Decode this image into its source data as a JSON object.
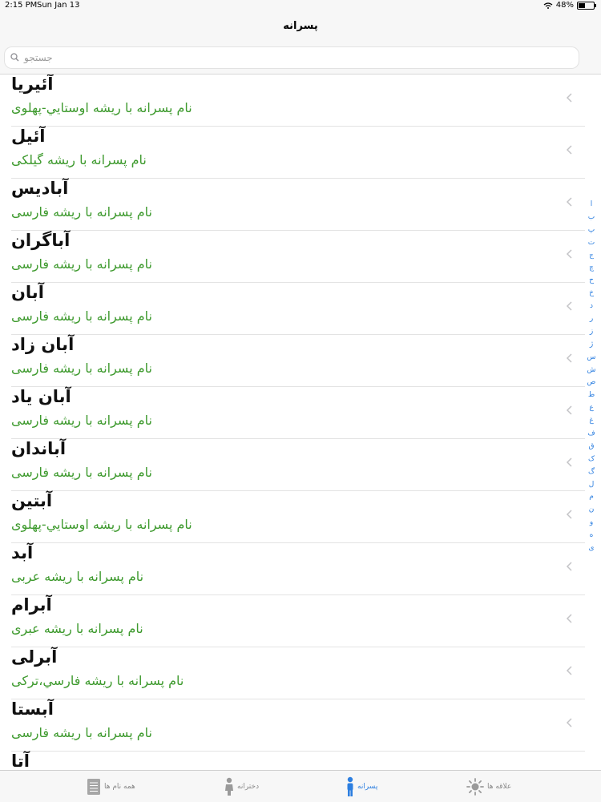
{
  "status": {
    "time": "2:15 PM",
    "date": "Sun Jan 13",
    "battery": "48%",
    "battery_level": 0.48
  },
  "nav": {
    "title": "پسرانه"
  },
  "search": {
    "placeholder": "جستجو"
  },
  "rows": [
    {
      "name": "آئيريا",
      "origin": "نام پسرانه با ریشه اوستايي-پهلوی"
    },
    {
      "name": "آئیل",
      "origin": "نام پسرانه با ریشه گیلکی"
    },
    {
      "name": "آبادیس",
      "origin": "نام پسرانه با ریشه فارسی"
    },
    {
      "name": "آباگران",
      "origin": "نام پسرانه با ریشه فارسی"
    },
    {
      "name": "آبان",
      "origin": "نام پسرانه با ریشه فارسی"
    },
    {
      "name": "آبان زاد",
      "origin": "نام پسرانه با ریشه فارسی"
    },
    {
      "name": "آبان یاد",
      "origin": "نام پسرانه با ریشه فارسی"
    },
    {
      "name": "آباندان",
      "origin": "نام پسرانه با ریشه فارسی"
    },
    {
      "name": "آبتین",
      "origin": "نام پسرانه با ریشه اوستايي-پهلوی"
    },
    {
      "name": "آبد",
      "origin": "نام پسرانه با ریشه عربی"
    },
    {
      "name": "آبرام",
      "origin": "نام پسرانه با ریشه عبری"
    },
    {
      "name": "آبرلی",
      "origin": "نام پسرانه با ریشه فارسي،ترکی"
    },
    {
      "name": "آبستا",
      "origin": "نام پسرانه با ریشه فارسی"
    },
    {
      "name": "آتا",
      "origin": ""
    }
  ],
  "index_letters": [
    "ا",
    "ب",
    "پ",
    "ت",
    "ج",
    "چ",
    "ح",
    "خ",
    "د",
    "ر",
    "ز",
    "ژ",
    "س",
    "ش",
    "ص",
    "ط",
    "ع",
    "غ",
    "ف",
    "ق",
    "ک",
    "گ",
    "ل",
    "م",
    "ن",
    "و",
    "ه",
    "ی"
  ],
  "tabs": [
    {
      "label": "همه نام ها",
      "icon": "list-icon"
    },
    {
      "label": "دخترانه",
      "icon": "girl-icon"
    },
    {
      "label": "پسرانه",
      "icon": "boy-icon"
    },
    {
      "label": "علاقه ها",
      "icon": "sun-icon"
    }
  ],
  "colors": {
    "accent": "#2d7fe0",
    "origin_text": "#3e9a2e",
    "tab_inactive": "#8a8a8a"
  }
}
